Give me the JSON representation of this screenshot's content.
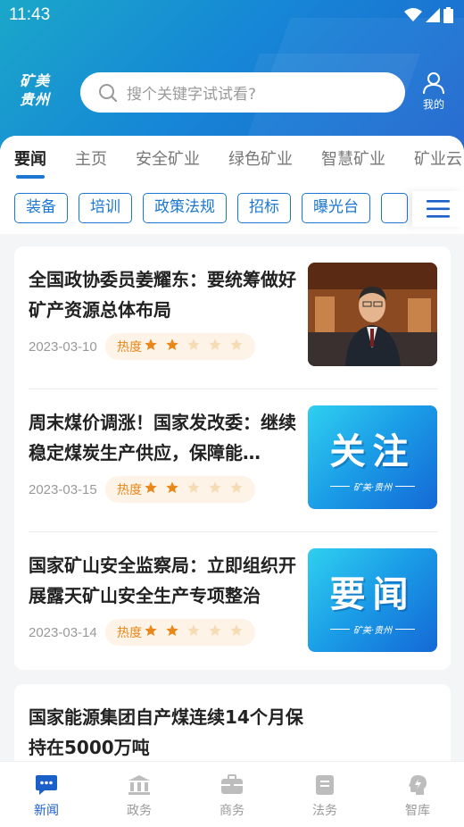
{
  "status": {
    "time": "11:43"
  },
  "header": {
    "logo_line1": "矿美",
    "logo_line2": "贵州",
    "search_placeholder": "搜个关键字试试看?",
    "mine_label": "我的"
  },
  "tabs": [
    {
      "label": "要闻",
      "active": true
    },
    {
      "label": "主页"
    },
    {
      "label": "安全矿业"
    },
    {
      "label": "绿色矿业"
    },
    {
      "label": "智慧矿业"
    },
    {
      "label": "矿业云"
    }
  ],
  "chips": [
    "装备",
    "培训",
    "政策法规",
    "招标",
    "曝光台"
  ],
  "news": [
    {
      "title": "全国政协委员姜耀东：要统筹做好矿产资源总体布局",
      "date": "2023-03-10",
      "heat_label": "热度",
      "heat_stars": 2,
      "thumb": "photo"
    },
    {
      "title": "周末煤价调涨！国家发改委：继续稳定煤炭生产供应，保障能…",
      "date": "2023-03-15",
      "heat_label": "热度",
      "heat_stars": 2,
      "thumb": "关注",
      "thumb_sub": "矿美·贵州"
    },
    {
      "title": "国家矿山安全监察局：立即组织开展露天矿山安全生产专项整治",
      "date": "2023-03-14",
      "heat_label": "热度",
      "heat_stars": 2,
      "thumb": "要闻",
      "thumb_sub": "矿美·贵州"
    },
    {
      "title": "国家能源集团自产煤连续14个月保持在5000万吨"
    }
  ],
  "bottom_nav": [
    {
      "label": "新闻",
      "icon": "chat-icon",
      "active": true
    },
    {
      "label": "政务",
      "icon": "government-icon"
    },
    {
      "label": "商务",
      "icon": "briefcase-icon"
    },
    {
      "label": "法务",
      "icon": "document-icon"
    },
    {
      "label": "智库",
      "icon": "brain-icon"
    }
  ],
  "colors": {
    "accent": "#1b77d1",
    "heat": "#e8881a"
  }
}
